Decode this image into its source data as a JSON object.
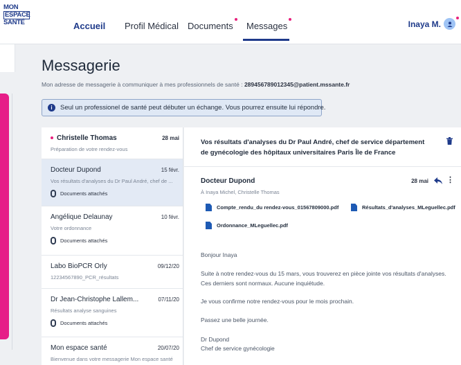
{
  "header": {
    "logo": [
      "MON",
      "ESPACE",
      "SANTÉ"
    ],
    "nav": [
      {
        "label": "Accueil"
      },
      {
        "label": "Profil Médical"
      },
      {
        "label": "Documents"
      },
      {
        "label": "Messages"
      }
    ],
    "user": "Inaya M."
  },
  "page": {
    "title": "Messagerie",
    "address_label": "Mon adresse de messagerie à communiquer à mes professionnels de santé :",
    "address_value": "289456789012345@patient.mssante.fr",
    "info": "Seul un professionel de santé peut débuter un échange. Vous pourrez ensuite lui répondre."
  },
  "messages": [
    {
      "name": "Christelle Thomas",
      "date": "28 mai",
      "preview": "Préparation de votre rendez-vous",
      "unread": true
    },
    {
      "name": "Docteur Dupond",
      "date": "15 févr.",
      "preview": "Vos résultats d'analyses du Dr Paul André, chef de ...",
      "attachments": "Documents attachés"
    },
    {
      "name": "Angélique Delaunay",
      "date": "10 févr.",
      "preview": "Votre ordonnance",
      "attachments": "Documents attachés"
    },
    {
      "name": "Labo BioPCR Orly",
      "date": "09/12/20",
      "preview": "12234567890_PCR_résultats"
    },
    {
      "name": "Dr Jean-Christophe Lallem...",
      "date": "07/11/20",
      "preview": "Résultats analyse sanguines",
      "attachments": "Documents attachés"
    },
    {
      "name": "Mon espace santé",
      "date": "20/07/20",
      "preview": "Bienvenue dans votre messagerie Mon espace santé"
    }
  ],
  "detail": {
    "subject": "Vos résultats d'analyses du Dr Paul André, chef de service département de gynécologie des hôpitaux universitaires Paris Île de France",
    "sender": "Docteur Dupond",
    "recipients": "À Inaya Michel, Christelle Thomas",
    "date": "28 mai",
    "files": [
      "Compte_rendu_du rendez-vous_01567809000.pdf",
      "Résultats_d'analyses_MLeguellec.pdf",
      "Ordonnance_MLeguellec.pdf"
    ],
    "body": [
      "Bonjour Inaya",
      "Suite à notre rendez-vous du 15 mars, vous trouverez en pièce jointe vos résultats d'analyses.",
      "Ces derniers sont normaux. Aucune inquiétude.",
      "Je vous confirme notre rendez-vous pour le mois prochain.",
      "Passez une belle journée.",
      "Dr Dupond",
      "Chef de service gynécologie"
    ]
  },
  "colors": {
    "primary": "#1e3a8a",
    "accent": "#e8217d",
    "selected": "#e3eaf5"
  }
}
